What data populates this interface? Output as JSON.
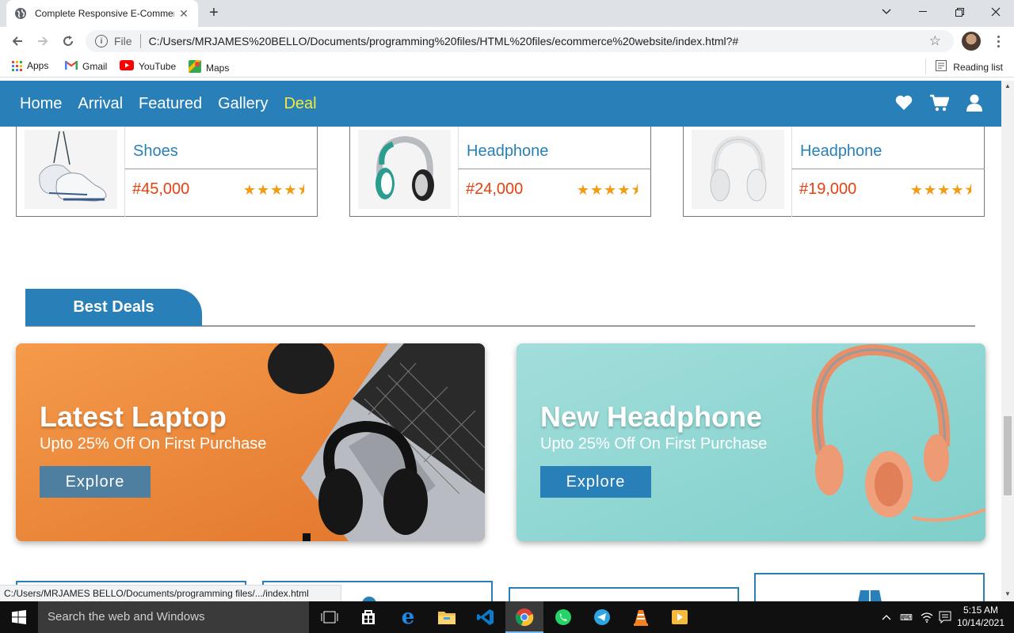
{
  "browser": {
    "tab_title": "Complete Responsive E-Commer",
    "tab_close": "✕",
    "new_tab": "+",
    "scheme": "File",
    "url": "C:/Users/MRJAMES%20BELLO/Documents/programming%20files/HTML%20files/ecommerce%20website/index.html?#",
    "bookmarks": [
      "Apps",
      "Gmail",
      "YouTube",
      "Maps"
    ],
    "reading_list": "Reading list",
    "status_url": "C:/Users/MRJAMES BELLO/Documents/programming files/.../index.html"
  },
  "nav": {
    "links": [
      "Home",
      "Arrival",
      "Featured",
      "Gallery",
      "Deal"
    ],
    "active": "Deal"
  },
  "products": [
    {
      "name": "Shoes",
      "price": "#45,000",
      "rating": 4.5
    },
    {
      "name": "Headphone",
      "price": "#24,000",
      "rating": 4.5
    },
    {
      "name": "Headphone",
      "price": "#19,000",
      "rating": 4.5
    }
  ],
  "deals": {
    "heading": "Best Deals",
    "banners": [
      {
        "title": "Latest Laptop",
        "subtitle": "Upto 25% Off On First Purchase",
        "button": "Explore"
      },
      {
        "title": "New Headphone",
        "subtitle": "Upto 25% Off On First Purchase",
        "button": "Explore"
      }
    ]
  },
  "taskbar": {
    "search_placeholder": "Search the web and Windows",
    "time": "5:15 AM",
    "date": "10/14/2021"
  },
  "colors": {
    "brand_blue": "#2980b9",
    "deal_yellow": "#f4ea3b",
    "price_red": "#e8400f",
    "star_orange": "#f39c12",
    "orange_banner": "#f08a3c",
    "teal_banner": "#8fd6d3"
  }
}
